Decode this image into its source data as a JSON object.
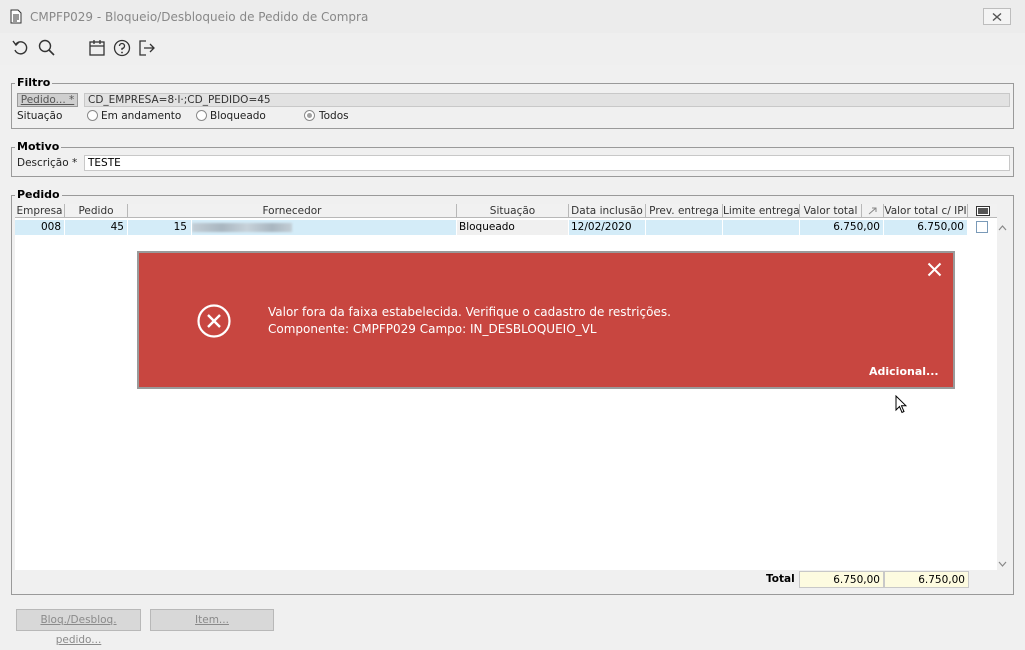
{
  "window": {
    "title": "CMPFP029 - Bloqueio/Desbloqueio de Pedido de Compra"
  },
  "toolbar": {
    "icons": [
      "undo-icon",
      "search-icon",
      "calendar-icon",
      "help-icon",
      "exit-icon"
    ]
  },
  "filtro": {
    "legend": "Filtro",
    "pedido_label": "Pedido... *",
    "pedido_value": "CD_EMPRESA=8·l·;CD_PEDIDO=45",
    "situacao_label": "Situação",
    "options": [
      "Em andamento",
      "Bloqueado",
      "Todos"
    ],
    "selected": "Todos"
  },
  "motivo": {
    "legend": "Motivo",
    "descricao_label": "Descrição *",
    "descricao_value": "TESTE"
  },
  "pedido": {
    "legend": "Pedido",
    "columns": [
      "Empresa",
      "Pedido",
      "Fornecedor",
      "Situação",
      "Data inclusão",
      "Prev. entrega",
      "Limite entrega",
      "Valor total",
      "Valor total c/ IPI"
    ],
    "row": {
      "empresa": "008",
      "pedido": "45",
      "fornecedor_cod": "15",
      "situacao": "Bloqueado",
      "data_inclusao": "12/02/2020",
      "prev_entrega": "",
      "limite_entrega": "",
      "valor_total": "6.750,00",
      "valor_total_ipi": "6.750,00"
    },
    "total_label": "Total",
    "total_valor": "6.750,00",
    "total_valor_ipi": "6.750,00"
  },
  "buttons": {
    "bloq": "Bloq./Desbloq. pedido...",
    "item": "Item..."
  },
  "toast": {
    "line1": "Valor fora da faixa estabelecida. Verifique o cadastro de restrições.",
    "line2": "Componente: CMPFP029 Campo: IN_DESBLOQUEIO_VL",
    "more": "Adicional...",
    "color": "#c84640"
  }
}
